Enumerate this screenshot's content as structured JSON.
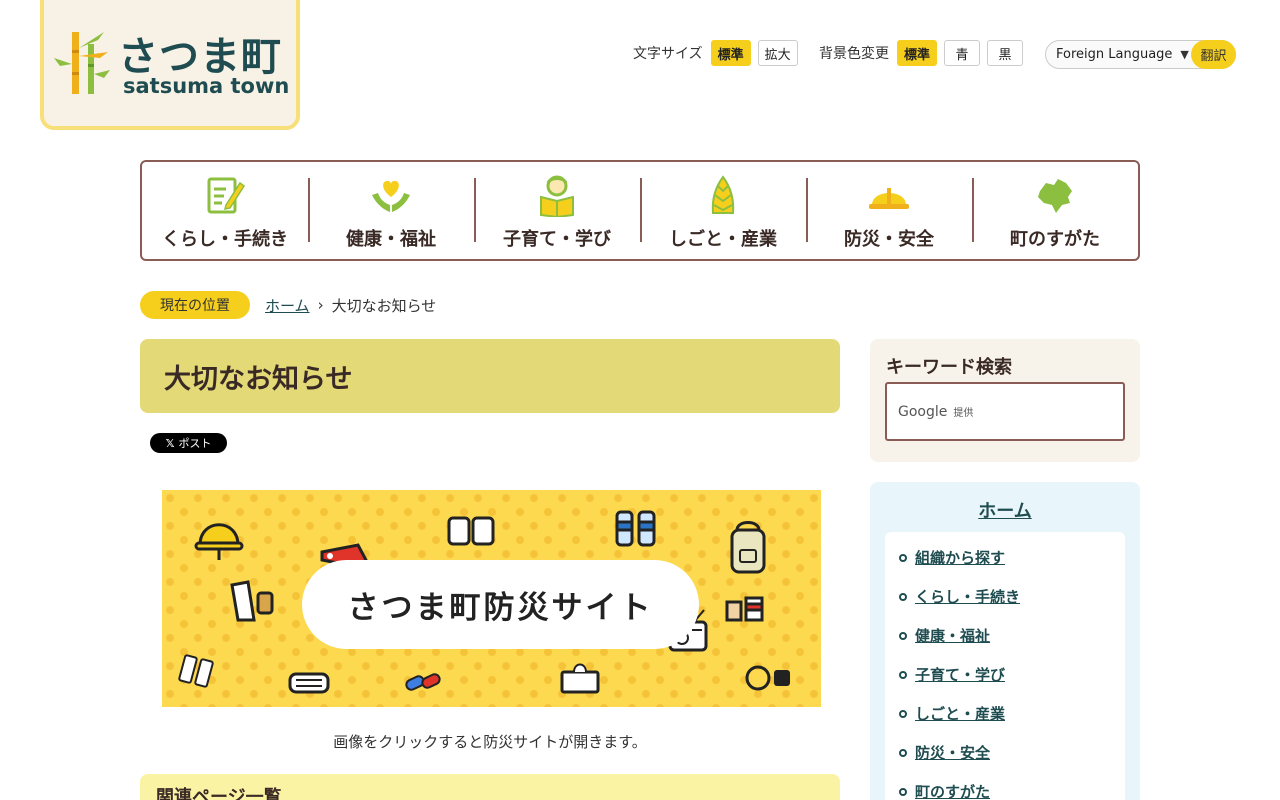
{
  "header": {
    "logo": {
      "name_jp": "さつま町",
      "name_en": "satsuma town"
    },
    "font_size": {
      "label": "文字サイズ",
      "standard": "標準",
      "large": "拡大"
    },
    "background": {
      "label": "背景色変更",
      "standard": "標準",
      "blue": "青",
      "black": "黒"
    },
    "language": {
      "select_label": "Foreign Language",
      "translate_button": "翻訳"
    }
  },
  "global_nav": {
    "items": [
      {
        "label": "くらし・手続き",
        "icon": "document-pen-icon"
      },
      {
        "label": "健康・福祉",
        "icon": "heart-hands-icon"
      },
      {
        "label": "子育て・学び",
        "icon": "child-book-icon"
      },
      {
        "label": "しごと・産業",
        "icon": "bamboo-shoot-icon"
      },
      {
        "label": "防災・安全",
        "icon": "helmet-icon"
      },
      {
        "label": "町のすがた",
        "icon": "town-map-icon"
      }
    ]
  },
  "breadcrumb": {
    "badge": "現在の位置",
    "home": "ホーム",
    "separator": "›",
    "current": "大切なお知らせ"
  },
  "main": {
    "title": "大切なお知らせ",
    "x_post": "ポスト",
    "banner_text": "さつま町防災サイト",
    "caption": "画像をクリックすると防災サイトが開きます。",
    "related_title": "関連ページ一覧"
  },
  "sidebar": {
    "search": {
      "title": "キーワード検索",
      "google": "Google",
      "provided": "提供"
    },
    "menu": {
      "home": "ホーム",
      "items": [
        {
          "label": "組織から探す"
        },
        {
          "label": "くらし・手続き"
        },
        {
          "label": "健康・福祉"
        },
        {
          "label": "子育て・学び"
        },
        {
          "label": "しごと・産業"
        },
        {
          "label": "防災・安全"
        },
        {
          "label": "町のすがた"
        }
      ]
    }
  },
  "colors": {
    "accent_yellow": "#f6cf1c",
    "brand_teal": "#1f4c50",
    "nav_border": "#8a5c56",
    "title_band": "#e3d977",
    "banner_bg": "#fcd94f",
    "icon_green": "#8cbf3f"
  }
}
